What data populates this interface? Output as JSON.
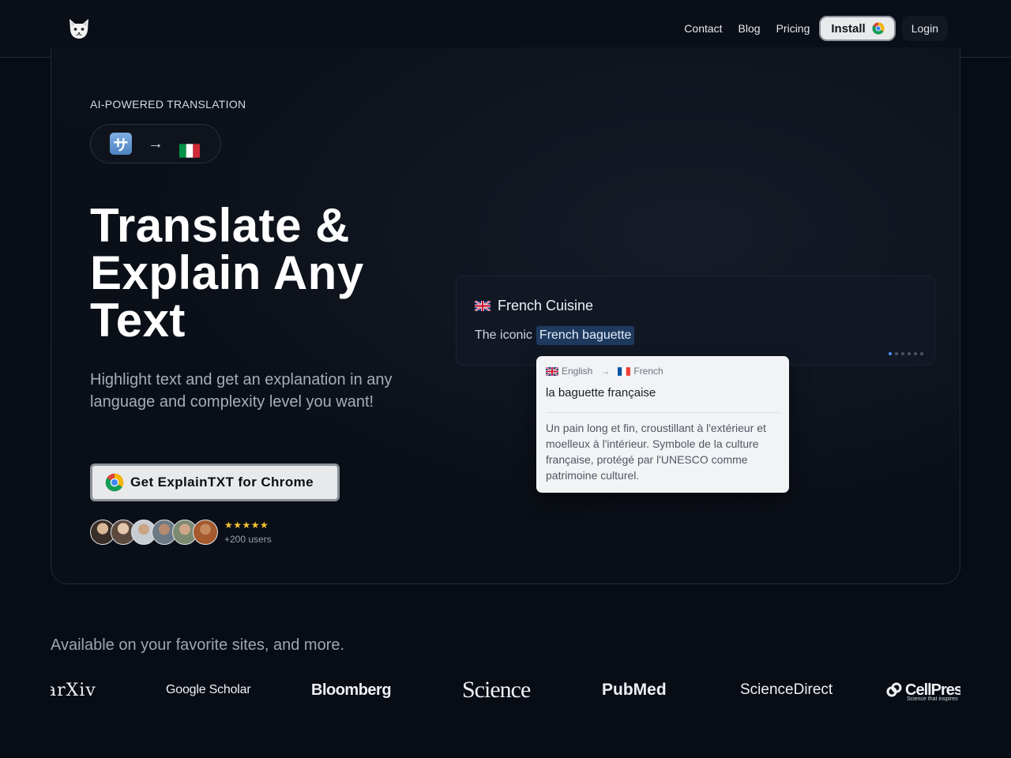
{
  "header": {
    "nav": [
      "Contact",
      "Blog",
      "Pricing"
    ],
    "install_label": "Install",
    "login_label": "Login"
  },
  "hero": {
    "eyebrow": "AI-POWERED TRANSLATION",
    "pill": {
      "source_glyph": "サ",
      "arrow": "→"
    },
    "headline": "Translate & Explain Any Text",
    "subtext": "Highlight text and get an explanation in any language and complexity level you want!",
    "cta_label": "Get ExplainTXT for Chrome",
    "rating_stars": "★★★★★",
    "rating_value": 5,
    "users_label": "+200 users"
  },
  "demo": {
    "title": "French Cuisine",
    "sentence_prefix": "The iconic",
    "highlighted": "French baguette",
    "carousel_active_index": 0,
    "carousel_count": 6,
    "popup": {
      "from_lang": "English",
      "to_lang": "French",
      "translation": "la baguette française",
      "explanation": "Un pain long et fin, croustillant à l'extérieur et moelleux à l'intérieur. Symbole de la culture française, protégé par l'UNESCO comme patrimoine culturel."
    }
  },
  "sites": {
    "heading": "Available on your favorite sites, and more.",
    "logos": {
      "arxiv": "arXiv",
      "scholar": "Google Scholar",
      "bloomberg": "Bloomberg",
      "science": "Science",
      "pubmed": "PubMed",
      "sciencedirect": "ScienceDirect",
      "cellpress": "CellPress",
      "cellpress_tagline": "Science that inspires"
    }
  },
  "colors": {
    "background": "#080c14",
    "accent_highlight": "#1e3a5f",
    "star": "#f4c431",
    "carousel_active": "#4b8ef0"
  },
  "icons": [
    "cat-logo-icon",
    "chrome-icon",
    "kana-icon",
    "arrow-right-icon",
    "italy-flag-icon",
    "uk-flag-icon",
    "france-flag-icon"
  ]
}
